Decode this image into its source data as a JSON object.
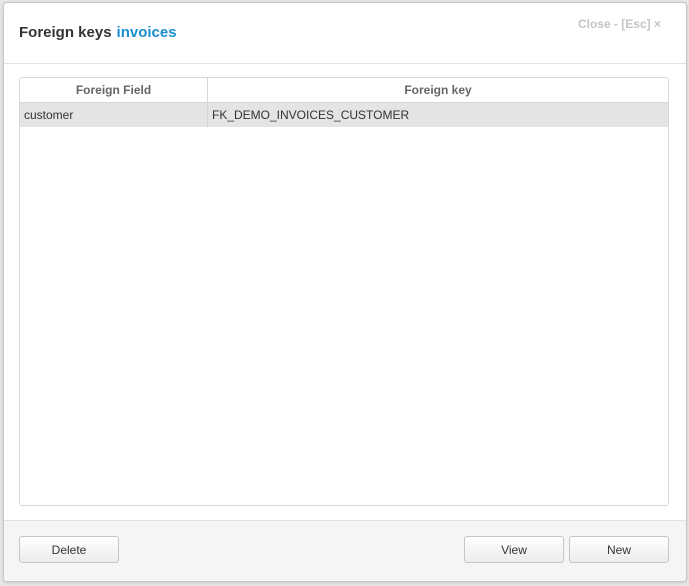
{
  "dialog": {
    "title": "Foreign keys",
    "subtitle": "invoices",
    "close_label": "Close - [Esc] ×"
  },
  "table": {
    "headers": [
      "Foreign Field",
      "Foreign key"
    ],
    "rows": [
      [
        "customer",
        "FK_DEMO_INVOICES_CUSTOMER"
      ]
    ]
  },
  "footer": {
    "delete_label": "Delete",
    "view_label": "View",
    "new_label": "New"
  },
  "colors": {
    "subtitle": "#1b8fd1",
    "selected_row": "#e4e4e4",
    "footer_bg": "#f5f5f5"
  }
}
